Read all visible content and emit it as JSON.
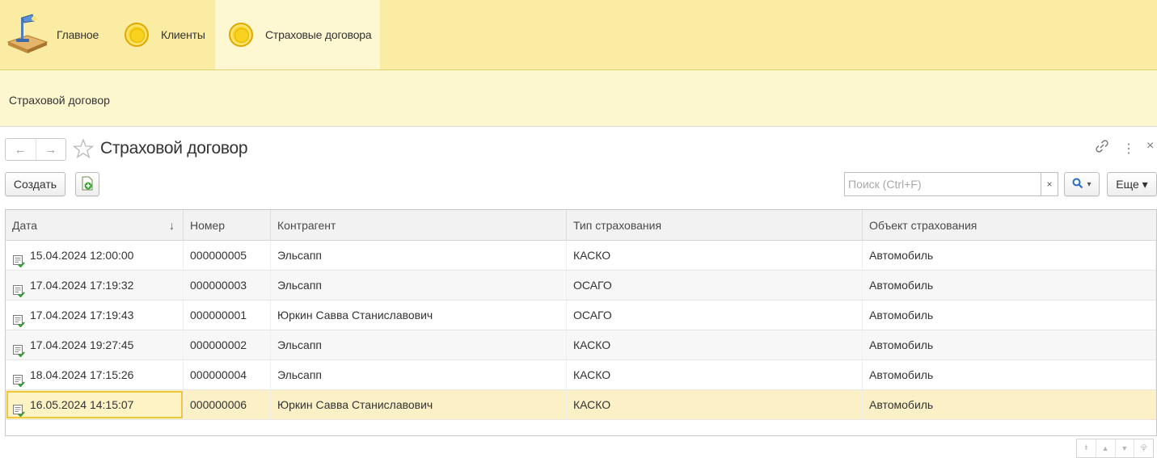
{
  "sections": [
    {
      "label": "Главное",
      "icon": "desk-lamp-icon",
      "active": false
    },
    {
      "label": "Клиенты",
      "icon": "coin-icon",
      "active": false
    },
    {
      "label": "Страховые договора",
      "icon": "coin-icon",
      "active": true
    }
  ],
  "function_panel": {
    "link": "Страховой договор"
  },
  "form": {
    "title": "Страховой договор",
    "back_icon": "←",
    "forward_icon": "→",
    "link_icon": "🔗",
    "more_icon": "⋮",
    "close_icon": "×"
  },
  "toolbar": {
    "create_label": "Создать",
    "search_placeholder": "Поиск (Ctrl+F)",
    "search_clear": "×",
    "search_button": "▾",
    "more_label": "Еще ▾"
  },
  "table": {
    "columns": [
      "Дата",
      "Номер",
      "Контрагент",
      "Тип страхования",
      "Объект страхования"
    ],
    "sort_indicator": "↓",
    "rows": [
      {
        "date": "15.04.2024 12:00:00",
        "number": "000000005",
        "counterparty": "Эльсапп",
        "type": "КАСКО",
        "object": "Автомобиль"
      },
      {
        "date": "17.04.2024 17:19:32",
        "number": "000000003",
        "counterparty": "Эльсапп",
        "type": "ОСАГО",
        "object": "Автомобиль"
      },
      {
        "date": "17.04.2024 17:19:43",
        "number": "000000001",
        "counterparty": "Юркин Савва Станиславович",
        "type": "ОСАГО",
        "object": "Автомобиль"
      },
      {
        "date": "17.04.2024 19:27:45",
        "number": "000000002",
        "counterparty": "Эльсапп",
        "type": "КАСКО",
        "object": "Автомобиль"
      },
      {
        "date": "18.04.2024 17:15:26",
        "number": "000000004",
        "counterparty": "Эльсапп",
        "type": "КАСКО",
        "object": "Автомобиль"
      },
      {
        "date": "16.05.2024 14:15:07",
        "number": "000000006",
        "counterparty": "Юркин Савва Станиславович",
        "type": "КАСКО",
        "object": "Автомобиль"
      }
    ],
    "selected_row": 5
  },
  "pager": [
    "⯒",
    "▲",
    "▼",
    "⯓"
  ],
  "colors": {
    "sections_bg": "#fbeca3",
    "function_bg": "#fdf7d0",
    "selected_row": "#fbf0c6",
    "accent": "#f0c63a"
  }
}
